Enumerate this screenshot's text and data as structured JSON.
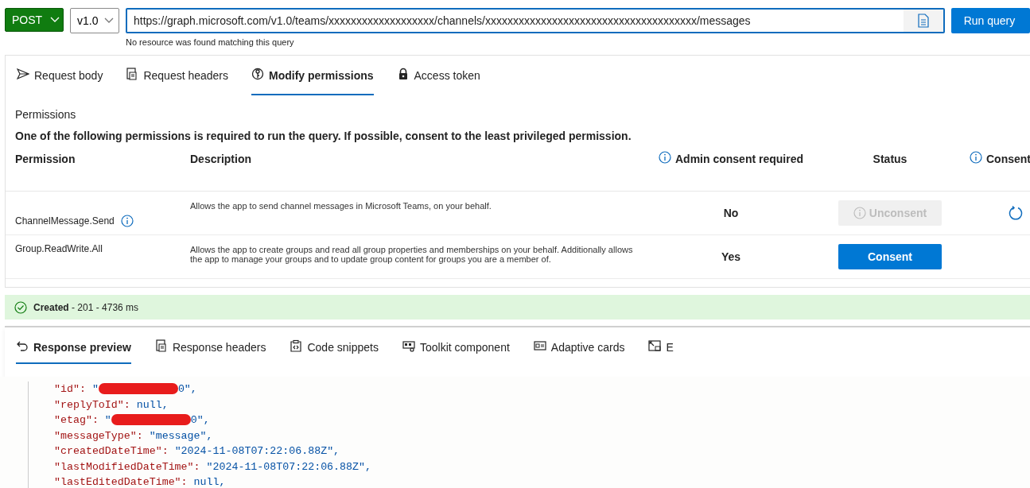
{
  "query_bar": {
    "method": "POST",
    "version": "v1.0",
    "url": "https://graph.microsoft.com/v1.0/teams/xxxxxxxxxxxxxxxxxxx/channels/xxxxxxxxxxxxxxxxxxxxxxxxxxxxxxxxxxxxxx/messages",
    "hint": "No resource was found matching this query",
    "run_button": "Run query"
  },
  "request_tabs": [
    {
      "label": "Request body",
      "selected": false
    },
    {
      "label": "Request headers",
      "selected": false
    },
    {
      "label": "Modify permissions",
      "selected": true
    },
    {
      "label": "Access token",
      "selected": false
    }
  ],
  "permissions": {
    "title": "Permissions",
    "note": "One of the following permissions is required to run the query. If possible, consent to the least privileged permission.",
    "columns": [
      {
        "label": "Permission",
        "info": false
      },
      {
        "label": "Description",
        "info": false
      },
      {
        "label": "Admin consent required",
        "info": true
      },
      {
        "label": "Status",
        "info": false
      },
      {
        "label": "Consent",
        "info": true
      }
    ],
    "rows": [
      {
        "name": "ChannelMessage.Send",
        "info": true,
        "description": "Allows the app to send channel messages in Microsoft Teams, on your behalf.",
        "admin_consent": "No",
        "status": {
          "label": "Unconsent",
          "disabled": true
        },
        "loading": true
      },
      {
        "name": "Group.ReadWrite.All",
        "info": false,
        "description": "Allows the app to create groups and read all group properties and memberships on your behalf. Additionally allows the app to manage your groups and to update group content for groups you are a member of.",
        "admin_consent": "Yes",
        "status": {
          "label": "Consent",
          "disabled": false
        },
        "loading": false
      }
    ]
  },
  "status_bar": {
    "text": "**Created** - 201 - 4736 ms"
  },
  "response_tabs": [
    {
      "label": "Response preview",
      "selected": true
    },
    {
      "label": "Response headers",
      "selected": false
    },
    {
      "label": "Code snippets",
      "selected": false
    },
    {
      "label": "Toolkit component",
      "selected": false
    },
    {
      "label": "Adaptive cards",
      "selected": false
    },
    {
      "label": "E",
      "selected": false
    }
  ],
  "response_lines": [
    {
      "key": "\"id\":",
      "kind": "redacted",
      "value_start": "\"",
      "value_end": "0\","
    },
    {
      "key": "\"replyToId\":",
      "kind": "literal",
      "value": "null,"
    },
    {
      "key": "\"etag\":",
      "kind": "redacted",
      "value_start": "\"",
      "value_end": "0\","
    },
    {
      "key": "\"messageType\":",
      "kind": "string",
      "value": "\"message\","
    },
    {
      "key": "\"createdDateTime\":",
      "kind": "string",
      "value": "\"2024-11-08T07:22:06.88Z\","
    },
    {
      "key": "\"lastModifiedDateTime\":",
      "kind": "string",
      "value": "\"2024-11-08T07:22:06.88Z\","
    },
    {
      "key": "\"lastEditedDateTime\":",
      "kind": "literal",
      "value": "null,"
    }
  ]
}
